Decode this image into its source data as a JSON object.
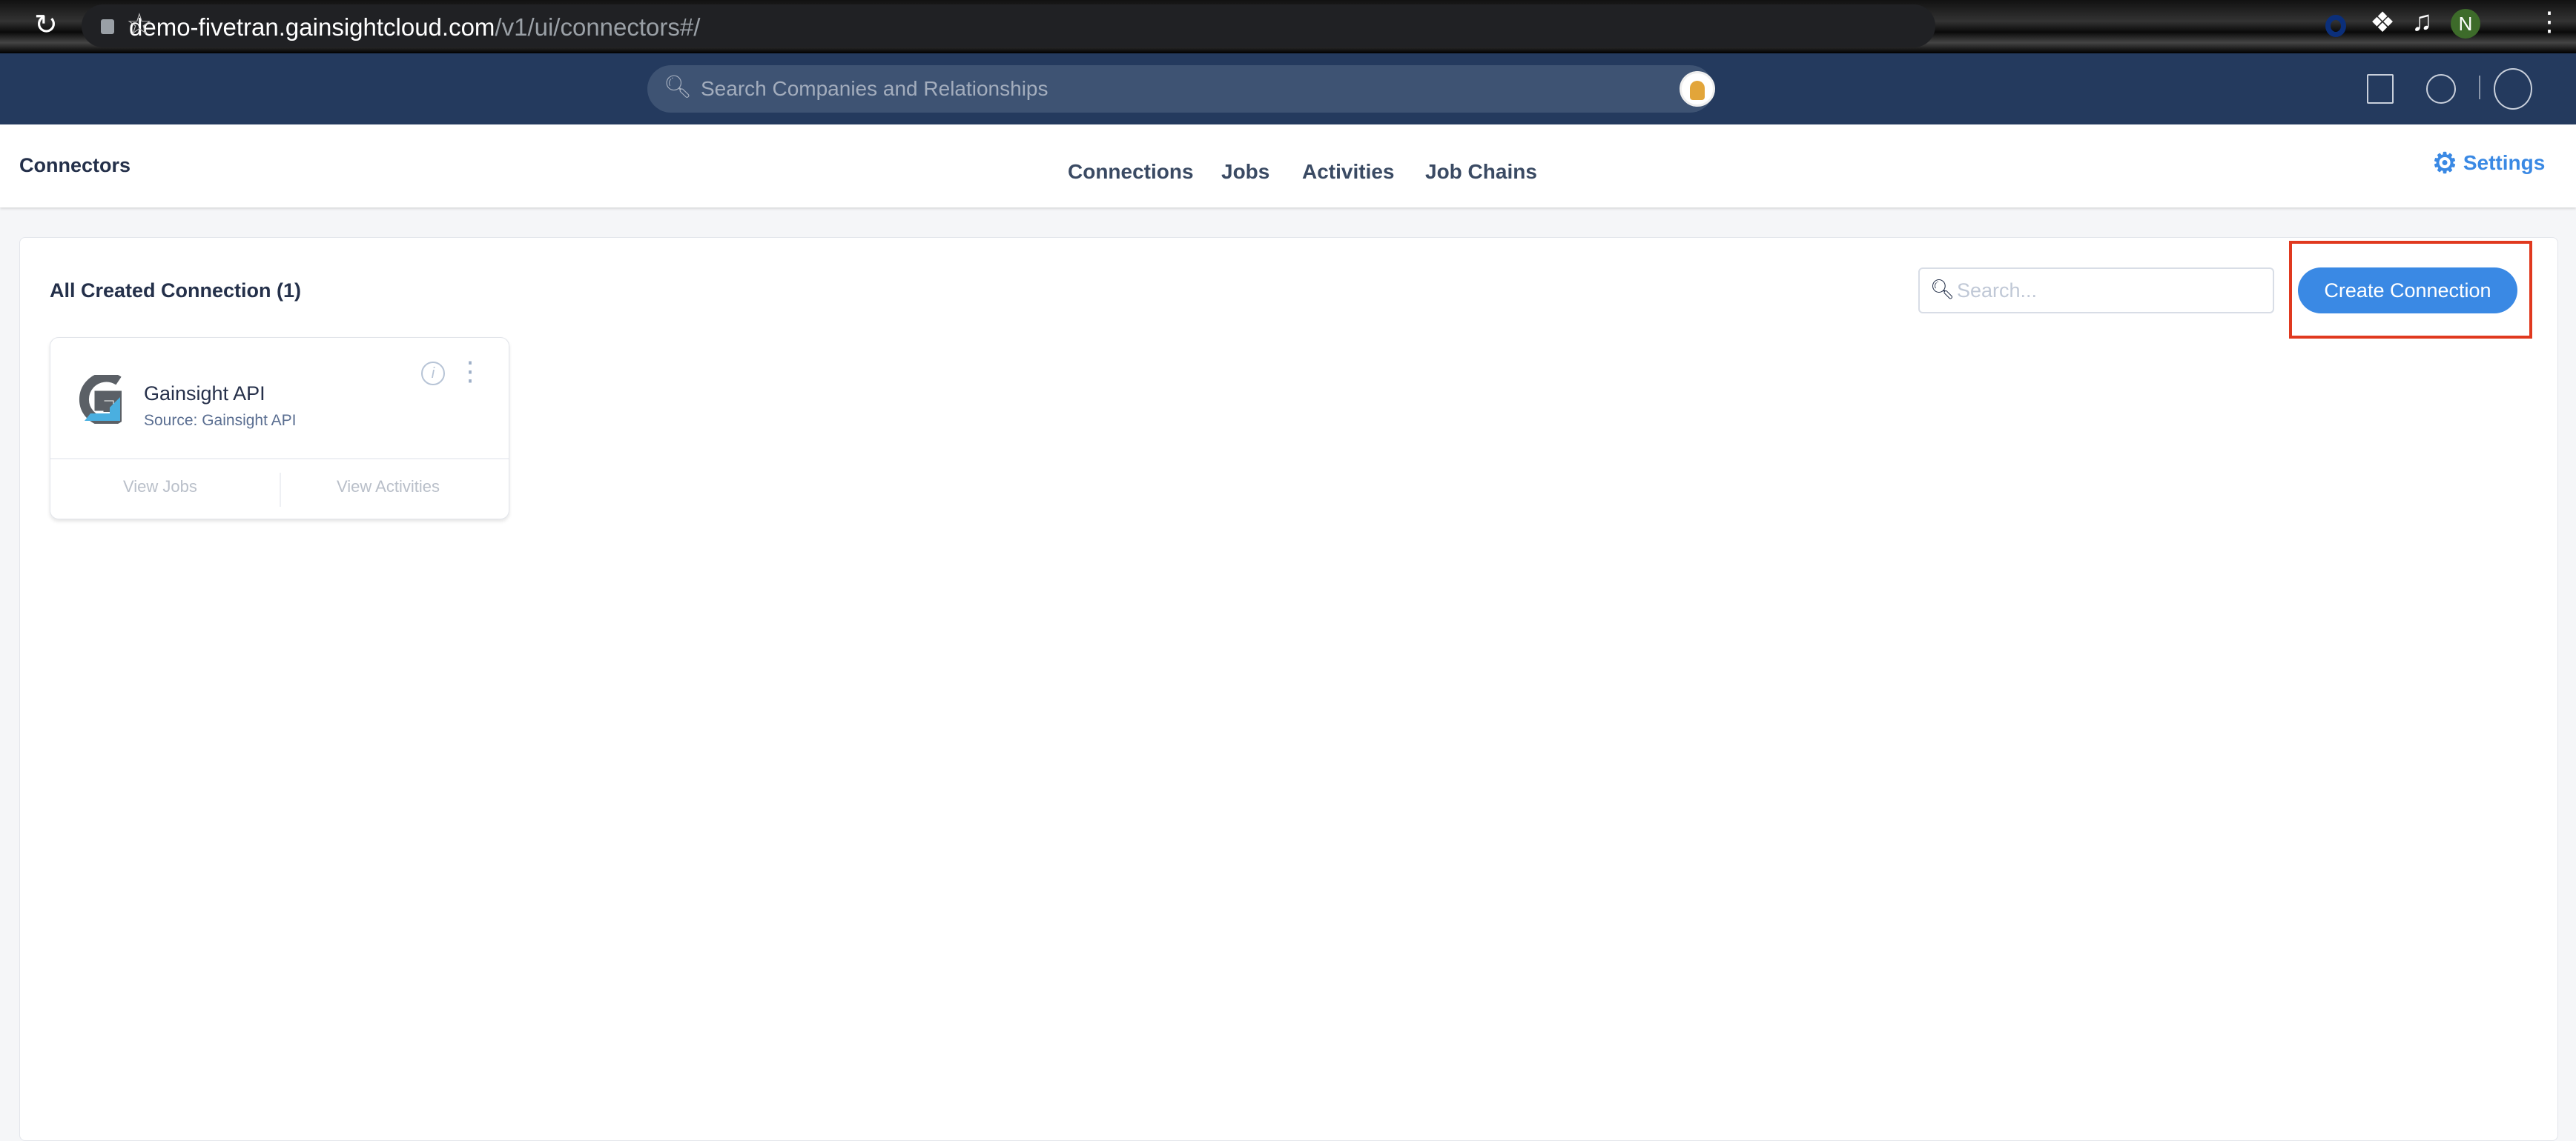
{
  "browser": {
    "url_host": "demo-fivetran.gainsightcloud.com",
    "url_path": "/v1/ui/connectors#/",
    "profile_initial": "N",
    "icons": [
      "back-icon",
      "reload-icon",
      "lock-icon",
      "star-icon",
      "extension-icon",
      "puzzle-icon",
      "media-icon",
      "menu-icon"
    ]
  },
  "topnav": {
    "search_placeholder": "Search Companies and Relationships",
    "icons": [
      "book-icon",
      "people-icon",
      "user-avatar-icon"
    ]
  },
  "header": {
    "title": "Connectors",
    "tabs": [
      {
        "label": "Connections"
      },
      {
        "label": "Jobs"
      },
      {
        "label": "Activities"
      },
      {
        "label": "Job Chains"
      }
    ],
    "settings_label": "Settings"
  },
  "panel": {
    "title": "All Created Connection (1)",
    "search_placeholder": "Search...",
    "create_label": "Create Connection",
    "accent": "#3a89e4",
    "highlight": "#e0391f"
  },
  "connections": [
    {
      "name": "Gainsight API",
      "source": "Source: Gainsight API",
      "view_jobs": "View Jobs",
      "view_activities": "View Activities"
    }
  ]
}
